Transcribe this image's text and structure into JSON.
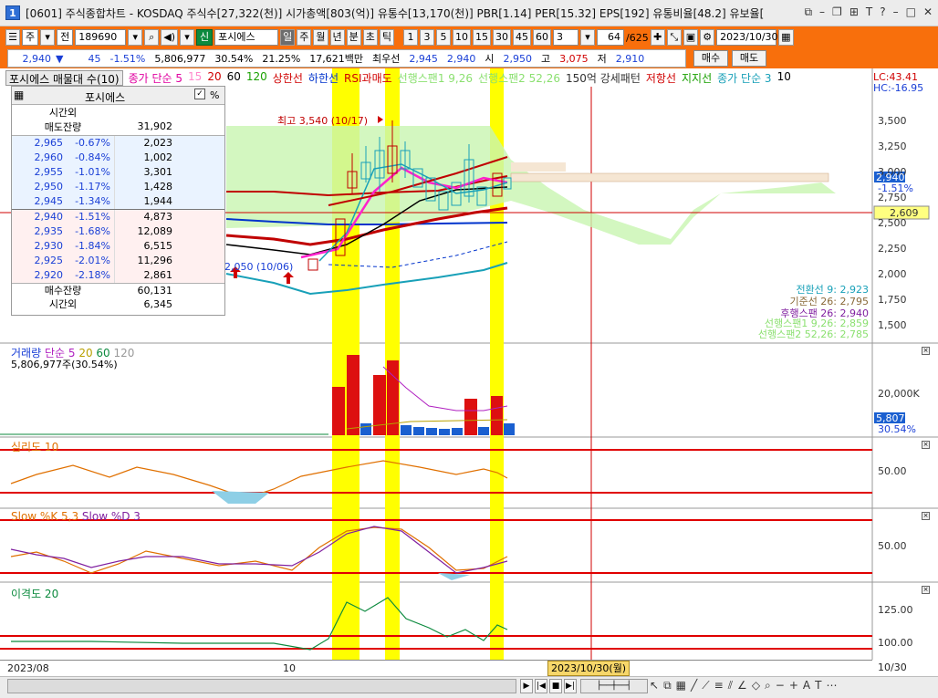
{
  "window": {
    "badge": "1",
    "title": "[0601] 주식종합차트 - KOSDAQ 주식수[27,322(천)] 시가총액[803(억)] 유통수[13,170(천)] PBR[1.14] PER[15.32] EPS[192] 유통비율[48.2] 유보율["
  },
  "toolbar": {
    "market": "주",
    "type": "전",
    "code": "189690",
    "name_badge": "신",
    "name": "포시에스",
    "periods": [
      "일",
      "주",
      "월",
      "년",
      "분",
      "초",
      "틱"
    ],
    "active_period": "일",
    "intervals": [
      "1",
      "3",
      "5",
      "10",
      "15",
      "30",
      "45",
      "60"
    ],
    "interval_value": "3",
    "count": "64",
    "total": "/625",
    "date": "2023/10/30"
  },
  "quote": {
    "price": "2,940",
    "arrow": "▼",
    "change": "45",
    "change_pct": "-1.51%",
    "volume": "5,806,977",
    "vol_ratio": "30.54%",
    "turnover": "21.25%",
    "amount": "17,621백만",
    "best_label": "최우선",
    "ask": "2,945",
    "bid": "2,940",
    "open_label": "시",
    "open": "2,950",
    "high_label": "고",
    "high": "3,075",
    "low_label": "저",
    "low": "2,910",
    "buy_btn": "매수",
    "sell_btn": "매도"
  },
  "legend": {
    "price_title": "포시에스 매물대 수(10)",
    "sma": "종가 단순 5",
    "p15": "15",
    "p20": "20",
    "p60": "60",
    "p120": "120",
    "upper": "상한선",
    "lower": "하한선",
    "rsi": "RSI과매도",
    "span1": "선행스팬1 9,26",
    "span2": "선행스팬2 52,26",
    "pattern": "150억 강세패턴",
    "resist": "저항선",
    "support": "지지선",
    "sma3": "종가 단순 3",
    "sma3_val": "10",
    "lc": "LC:43.41",
    "hc": "HC:-16.95"
  },
  "orderbook": {
    "title": "포시에스",
    "pct_label": "%",
    "header_l1": "시간외",
    "header_l2": "매도잔량",
    "header_val": "31,902",
    "asks": [
      {
        "price": "2,965",
        "pct": "-0.67%",
        "qty": "2,023"
      },
      {
        "price": "2,960",
        "pct": "-0.84%",
        "qty": "1,002"
      },
      {
        "price": "2,955",
        "pct": "-1.01%",
        "qty": "3,301"
      },
      {
        "price": "2,950",
        "pct": "-1.17%",
        "qty": "1,428"
      },
      {
        "price": "2,945",
        "pct": "-1.34%",
        "qty": "1,944"
      }
    ],
    "bids": [
      {
        "price": "2,940",
        "pct": "-1.51%",
        "qty": "4,873"
      },
      {
        "price": "2,935",
        "pct": "-1.68%",
        "qty": "12,089"
      },
      {
        "price": "2,930",
        "pct": "-1.84%",
        "qty": "6,515"
      },
      {
        "price": "2,925",
        "pct": "-2.01%",
        "qty": "11,296"
      },
      {
        "price": "2,920",
        "pct": "-2.18%",
        "qty": "2,861"
      }
    ],
    "bid_total_label": "매수잔량",
    "bid_total": "60,131",
    "after_label": "시간외",
    "after_val": "6,345"
  },
  "annotations": {
    "high_mark": "최고 3,540 (10/17)",
    "low_mark": "2,050 (10/06)",
    "ichimoku": {
      "conv": "전환선 9: 2,923",
      "base": "기준선 26: 2,795",
      "lag": "후행스팬 26: 2,940",
      "lead1": "선행스팬1 9,26: 2,859",
      "lead2": "선행스팬2 52,26: 2,785"
    }
  },
  "price_axis": {
    "ticks": [
      "3,500",
      "3,250",
      "3,000",
      "2,750",
      "2,500",
      "2,250",
      "2,000",
      "1,750",
      "1,500"
    ],
    "current": "2,940",
    "current_pct": "-1.51%",
    "line_val": "2,609"
  },
  "volume_pane": {
    "title": "거래량",
    "sma": "단순 5",
    "p20": "20",
    "p60": "60",
    "p120": "120",
    "value": "5,806,977주(30.54%)",
    "tick": "20,000K",
    "current": "5,807K",
    "current_pct": "30.54%"
  },
  "psy_pane": {
    "title": "심리도 10",
    "tick": "50.00"
  },
  "slow_pane": {
    "title_k": "Slow %K 5,3",
    "title_d": "Slow %D 3",
    "tick": "50.00"
  },
  "disp_pane": {
    "title": "이격도 20",
    "tick1": "125.00",
    "tick2": "100.00"
  },
  "date_axis": {
    "left": "2023/08",
    "mid": "10",
    "cursor": "2023/10/30(월)",
    "right": "10/30"
  },
  "colors": {
    "accent": "#f86f0c",
    "up": "#d00000",
    "down": "#1a3fd6",
    "highlight": "#ffff00"
  }
}
